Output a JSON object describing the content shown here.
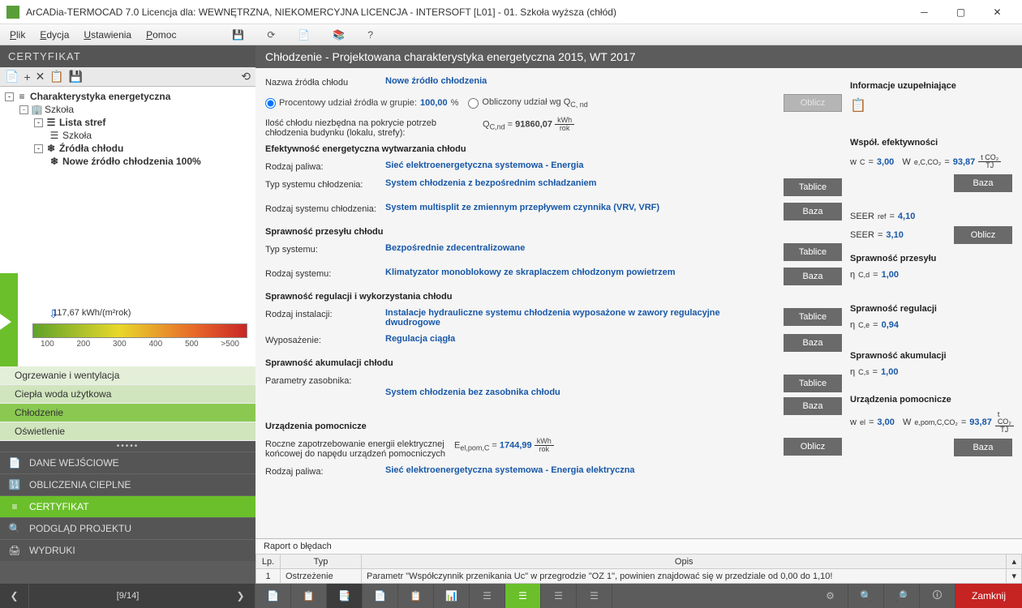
{
  "titlebar": {
    "title": "ArCADia-TERMOCAD 7.0 Licencja dla: WEWNĘTRZNA, NIEKOMERCYJNA LICENCJA - INTERSOFT [L01] - 01. Szkoła wyższa (chłód)"
  },
  "menu": {
    "plik": "Plik",
    "edycja": "Edycja",
    "ustawienia": "Ustawienia",
    "pomoc": "Pomoc"
  },
  "left": {
    "header": "CERTYFIKAT",
    "tree": {
      "root": "Charakterystyka energetyczna",
      "szkola": "Szkoła",
      "lista_stref": "Lista stref",
      "szkola2": "Szkoła",
      "zrodla_chlodu": "Źródła chłodu",
      "nowe_zrodlo": "Nowe źródło chłodzenia 100%"
    },
    "gauge": {
      "label": "117,67 kWh/(m²rok)",
      "ticks": [
        "100",
        "200",
        "300",
        "400",
        "500",
        ">500"
      ]
    },
    "cats": {
      "ogrzewanie": "Ogrzewanie i wentylacja",
      "ciepla": "Ciepła woda użytkowa",
      "chlodzenie": "Chłodzenie",
      "oswietlenie": "Oświetlenie"
    },
    "nav": {
      "dane": "DANE WEJŚCIOWE",
      "obliczenia": "OBLICZENIA CIEPLNE",
      "certyfikat": "CERTYFIKAT",
      "podglad": "PODGLĄD PROJEKTU",
      "wydruki": "WYDRUKI"
    }
  },
  "content": {
    "header": "Chłodzenie - Projektowana charakterystyka energetyczna 2015, WT 2017",
    "labels": {
      "nazwa_zrodla": "Nazwa źródła chłodu",
      "procentowy": "Procentowy udział źródła w grupie:",
      "procent": "100,00",
      "pct": "%",
      "obliczony": "Obliczony udział wg Q",
      "oblicz": "Oblicz",
      "ilosc_chlodu": "Ilość chłodu niezbędna na pokrycie potrzeb chłodzenia budynku (lokalu, strefy):",
      "qcnd_val": "91860,07",
      "sec_efektywnosc": "Efektywność energetyczna wytwarzania chłodu",
      "rodzaj_paliwa": "Rodzaj paliwa:",
      "typ_systemu_ch": "Typ systemu chłodzenia:",
      "rodzaj_systemu_ch": "Rodzaj systemu chłodzenia:",
      "sec_przesyl": "Sprawność przesyłu chłodu",
      "typ_systemu": "Typ systemu:",
      "rodzaj_systemu": "Rodzaj systemu:",
      "sec_regulacja": "Sprawność regulacji i wykorzystania chłodu",
      "rodzaj_instalacji": "Rodzaj instalacji:",
      "wyposazenie": "Wyposażenie:",
      "sec_akumulacja": "Sprawność akumulacji chłodu",
      "parametry_zasobnika": "Parametry zasobnika:",
      "sec_urzadzenia": "Urządzenia pomocnicze",
      "roczne": "Roczne zapotrzebowanie energii elektrycznej końcowej do napędu urządzeń pomocniczych",
      "eelpom_val": "1744,99",
      "rodzaj_paliwa2": "Rodzaj paliwa:",
      "btn_tablice": "Tablice",
      "btn_baza": "Baza",
      "btn_oblicz": "Oblicz"
    },
    "values": {
      "nazwa_zrodla": "Nowe źródło chłodzenia",
      "rodzaj_paliwa": "Sieć elektroenergetyczna systemowa - Energia",
      "typ_systemu_ch": "System chłodzenia z bezpośrednim schładzaniem",
      "rodzaj_systemu_ch": "System multisplit ze zmiennym przepływem czynnika (VRV, VRF)",
      "typ_systemu": "Bezpośrednie zdecentralizowane",
      "rodzaj_systemu": "Klimatyzator monoblokowy ze skraplaczem chłodzonym powietrzem",
      "rodzaj_instalacji": "Instalacje hydrauliczne systemu chłodzenia wyposażone w zawory regulacyjne dwudrogowe",
      "wyposazenie": "Regulacja ciągła",
      "parametry_zasobnika": "System chłodzenia bez zasobnika chłodu",
      "rodzaj_paliwa2": "Sieć elektroenergetyczna systemowa - Energia elektryczna"
    },
    "side": {
      "info_head": "Informacje uzupełniające",
      "wspol_head": "Współ. efektywności",
      "wc": "3,00",
      "wecco2": "93,87",
      "seer_ref": "4,10",
      "seer": "3,10",
      "przesyl_head": "Sprawność przesyłu",
      "ncd": "1,00",
      "regulacja_head": "Sprawność regulacji",
      "nce": "0,94",
      "akumul_head": "Sprawność akumulacji",
      "ncs": "1,00",
      "urzadzenia_head": "Urządzenia pomocnicze",
      "wel": "3,00",
      "wepom": "93,87",
      "btn_baza": "Baza",
      "btn_oblicz": "Oblicz"
    }
  },
  "errors": {
    "raport": "Raport o błędach",
    "lp": "Lp.",
    "typ": "Typ",
    "opis": "Opis",
    "row1_lp": "1",
    "row1_typ": "Ostrzeżenie",
    "row1_opis": "Parametr \"Współczynnik przenikania Uc\" w przegrodzie \"OZ 1\", powinien znajdować się w przedziale od 0,00 do 1,10!"
  },
  "status": {
    "page": "[9/14]",
    "close": "Zamknij"
  }
}
